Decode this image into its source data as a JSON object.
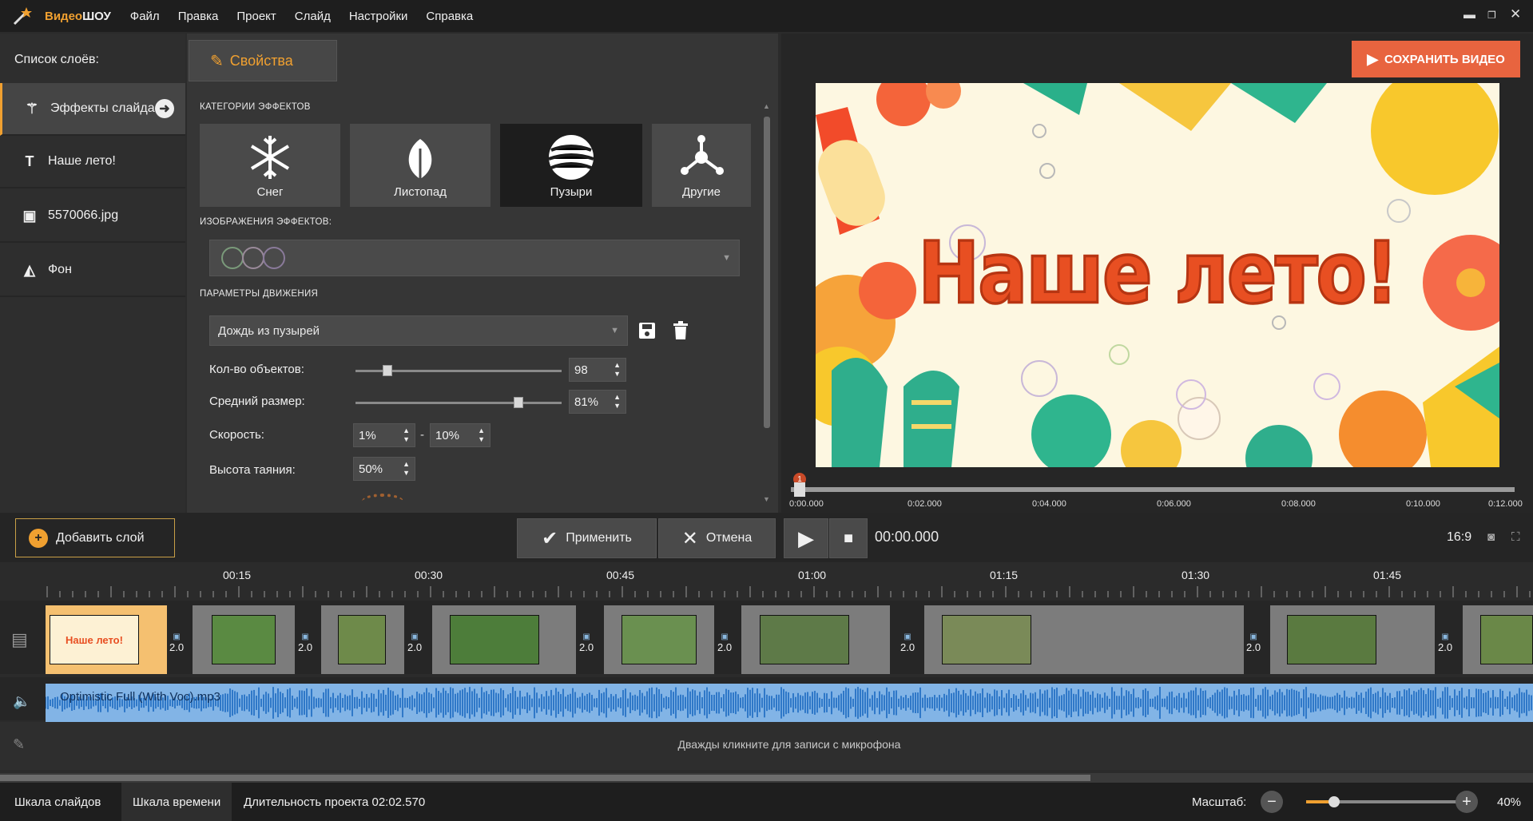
{
  "app": {
    "brand_a": "Видео",
    "brand_b": "ШОУ"
  },
  "menu": [
    "Файл",
    "Правка",
    "Проект",
    "Слайд",
    "Настройки",
    "Справка"
  ],
  "layers": {
    "title": "Список слоёв:",
    "items": [
      "Эффекты слайда",
      "Наше лето!",
      "5570066.jpg",
      "Фон"
    ]
  },
  "props": {
    "tab": "Свойства",
    "categories_title": "КАТЕГОРИИ ЭФФЕКТОВ",
    "categories": [
      "Снег",
      "Листопад",
      "Пузыри",
      "Другие"
    ],
    "selected_category": "Пузыри",
    "images_title": "ИЗОБРАЖЕНИЯ ЭФФЕКТОВ:",
    "motion_title": "ПАРАМЕТРЫ ДВИЖЕНИЯ",
    "motion_preset": "Дождь из пузырей",
    "params": {
      "count_label": "Кол-во объектов:",
      "count_value": "98",
      "size_label": "Средний размер:",
      "size_value": "81%",
      "speed_label": "Скорость:",
      "speed_min": "1%",
      "speed_sep": "-",
      "speed_max": "10%",
      "melt_label": "Высота таяния:",
      "melt_value": "50%"
    }
  },
  "preview": {
    "save_label": "СОХРАНИТЬ ВИДЕО",
    "title_text": "Наше лето!",
    "marker": "1",
    "ticks": [
      "0:00.000",
      "0:02.000",
      "0:04.000",
      "0:06.000",
      "0:08.000",
      "0:10.000",
      "0:12.000"
    ]
  },
  "toolbar": {
    "add_layer": "Добавить слой",
    "apply": "Применить",
    "cancel": "Отмена",
    "time": "00:00.000",
    "aspect": "16:9"
  },
  "timeline": {
    "ruler": [
      "00:15",
      "00:30",
      "00:45",
      "01:00",
      "01:15",
      "01:30",
      "01:45"
    ],
    "transition_value": "2.0",
    "first_clip_text": "Наше лето!",
    "audio": "Optimistic Full (With Voc).mp3",
    "mic_hint": "Дважды кликните для записи с микрофона"
  },
  "status": {
    "tab_slides": "Шкала слайдов",
    "tab_timeline": "Шкала времени",
    "duration": "Длительность проекта 02:02.570",
    "zoom_label": "Масштаб:",
    "zoom_value": "40%"
  },
  "colors": {
    "accent": "#f0a030",
    "save": "#e8643f",
    "audio": "#82b4e6"
  }
}
